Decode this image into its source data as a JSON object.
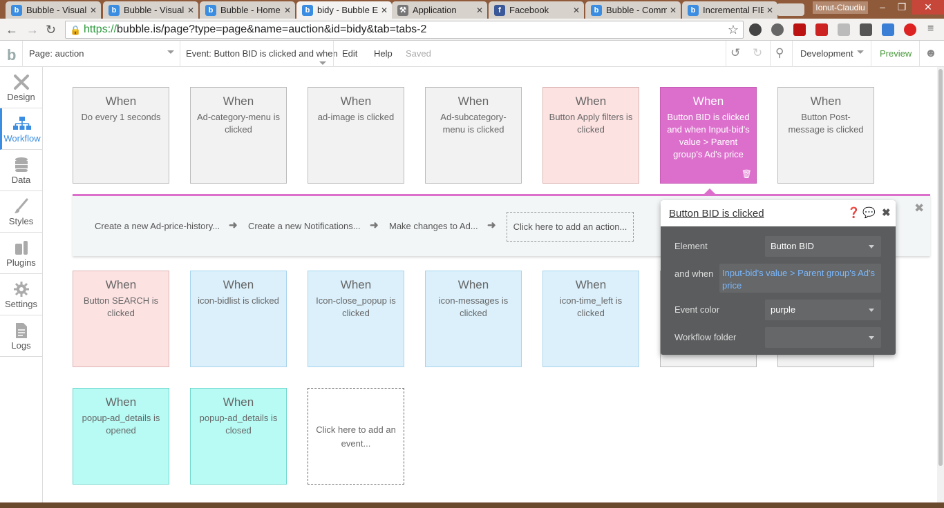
{
  "browser": {
    "tabs": [
      {
        "label": "Bubble - Visual",
        "icon": "bubble-favicon"
      },
      {
        "label": "Bubble - Visual",
        "icon": "bubble-favicon"
      },
      {
        "label": "Bubble - Home",
        "icon": "bubble-favicon"
      },
      {
        "label": "bidy - Bubble Ed",
        "icon": "bubble-favicon",
        "active": true
      },
      {
        "label": "Application",
        "icon": "tools-favicon"
      },
      {
        "label": "Facebook",
        "icon": "facebook-favicon"
      },
      {
        "label": "Bubble - Comm",
        "icon": "bubble-favicon"
      },
      {
        "label": "Incremental FIE",
        "icon": "bubble-favicon"
      }
    ],
    "user": "Ionut-Claudiu",
    "url_scheme": "https://",
    "url_rest": "bubble.is/page?type=page&name=auction&id=bidy&tab=tabs-2"
  },
  "header": {
    "page_label": "Page: auction",
    "event_label": "Event: Button BID is clicked and when",
    "edit": "Edit",
    "help": "Help",
    "saved": "Saved",
    "mode": "Development",
    "preview": "Preview"
  },
  "leftnav": [
    {
      "label": "Design",
      "icon": "design-icon"
    },
    {
      "label": "Workflow",
      "icon": "workflow-icon",
      "active": true
    },
    {
      "label": "Data",
      "icon": "data-icon"
    },
    {
      "label": "Styles",
      "icon": "styles-icon"
    },
    {
      "label": "Plugins",
      "icon": "plugins-icon"
    },
    {
      "label": "Settings",
      "icon": "settings-icon"
    },
    {
      "label": "Logs",
      "icon": "logs-icon"
    }
  ],
  "events_row1": [
    {
      "when": "When",
      "text": "Do every 1 seconds",
      "color": "grey"
    },
    {
      "when": "When",
      "text": "Ad-category-menu is clicked",
      "color": "grey"
    },
    {
      "when": "When",
      "text": "ad-image is clicked",
      "color": "grey"
    },
    {
      "when": "When",
      "text": "Ad-subcategory-menu is clicked",
      "color": "grey"
    },
    {
      "when": "When",
      "text": "Button Apply filters is clicked",
      "color": "pink"
    },
    {
      "when": "When",
      "text": "Button BID is clicked and when Input-bid's value > Parent group's Ad's price",
      "color": "purple"
    },
    {
      "when": "When",
      "text": "Button Post-message is clicked",
      "color": "grey"
    }
  ],
  "actions": [
    "Create a new Ad-price-history...",
    "Create a new Notifications...",
    "Make changes to Ad..."
  ],
  "add_action": "Click here to add an action...",
  "events_row2": [
    {
      "when": "When",
      "text": "Button SEARCH is clicked",
      "color": "pink"
    },
    {
      "when": "When",
      "text": "icon-bidlist is clicked",
      "color": "blue"
    },
    {
      "when": "When",
      "text": "Icon-close_popup is clicked",
      "color": "blue"
    },
    {
      "when": "When",
      "text": "icon-messages is clicked",
      "color": "blue"
    },
    {
      "when": "When",
      "text": "icon-time_left is clicked",
      "color": "blue"
    }
  ],
  "events_row3": [
    {
      "when": "When",
      "text": "popup-ad_details is opened",
      "color": "cyan"
    },
    {
      "when": "When",
      "text": "popup-ad_details is closed",
      "color": "cyan"
    }
  ],
  "add_event": "Click here to add an event...",
  "panel": {
    "title": "Button BID is clicked",
    "element_label": "Element",
    "element_value": "Button BID",
    "andwhen_label": "and when",
    "andwhen_value": "Input-bid's value > Parent group's Ad's price",
    "color_label": "Event color",
    "color_value": "purple",
    "folder_label": "Workflow folder",
    "folder_value": ""
  }
}
